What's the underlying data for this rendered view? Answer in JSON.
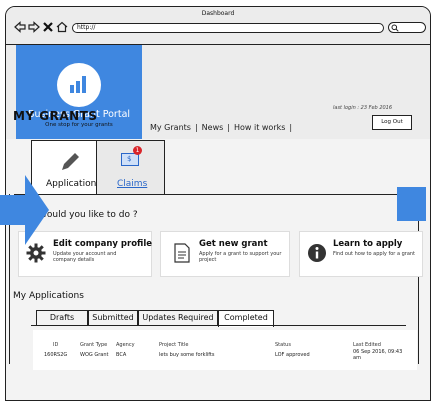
{
  "browser": {
    "title": "Dashboard",
    "url": "http://",
    "icons": [
      "back-icon",
      "forward-icon",
      "close-icon",
      "home-icon",
      "search-icon"
    ]
  },
  "brand": {
    "name": "Business Grant Portal",
    "tagline": "One stop for your grants",
    "color": "#3f87e0"
  },
  "topnav": {
    "items": [
      "My Grants",
      "News",
      "How it works"
    ],
    "separator": "|"
  },
  "logout_label": "Log Out",
  "page_title": "MY GRANTS",
  "last_login": "last login : 23 Feb 2016",
  "tabs": {
    "applications": "Applications",
    "claims": "Claims",
    "claims_badge": "1",
    "claims_icon_text": "$"
  },
  "question": "What would you like to do ?",
  "actions": [
    {
      "title": "Edit company profile",
      "desc": "Update your account and company details",
      "icon": "gear-icon"
    },
    {
      "title": "Get new grant",
      "desc": "Apply for a grant to support your project",
      "icon": "document-icon"
    },
    {
      "title": "Learn to apply",
      "desc": "Find out how to apply for a grant",
      "icon": "info-icon"
    }
  ],
  "my_applications": {
    "heading": "My Applications",
    "subtabs": [
      "Drafts",
      "Submitted",
      "Updates Required",
      "Completed"
    ],
    "active_subtab": "Completed",
    "columns": [
      "ID",
      "Grant Type",
      "Agency",
      "Project Title",
      "Status",
      "Last Edited"
    ],
    "rows": [
      {
        "id": "160RS2G",
        "grant_type": "WOG Grant",
        "agency": "BCA",
        "project_title": "lets buy some forklifts",
        "status": "LOF approved",
        "last_edited": "06 Sep 2016, 09:43 am"
      }
    ]
  }
}
